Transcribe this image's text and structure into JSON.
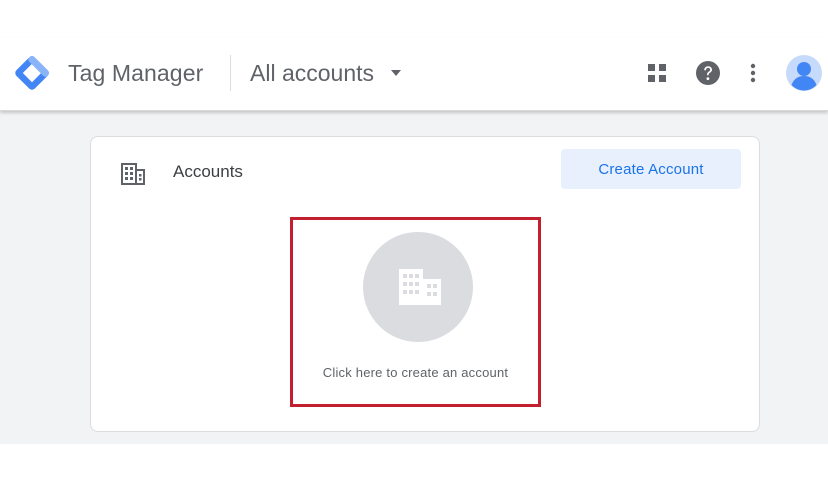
{
  "header": {
    "product_name": "Tag Manager",
    "account_selector_label": "All accounts"
  },
  "icons": {
    "logo": "tag-manager-logo",
    "caret": "dropdown-caret-icon",
    "apps": "apps-grid-icon",
    "help": "help-icon",
    "more": "more-vert-icon",
    "avatar": "account-avatar-icon",
    "card": "building-icon",
    "empty_state": "building-icon"
  },
  "card": {
    "title": "Accounts",
    "create_button_label": "Create Account",
    "empty_state_text": "Click here to create an account"
  },
  "colors": {
    "brand_blue": "#4285f4",
    "button_text": "#1a73e8",
    "button_bg": "#e8f0fe",
    "highlight_border": "#c2202f",
    "content_bg": "#f1f3f4"
  }
}
